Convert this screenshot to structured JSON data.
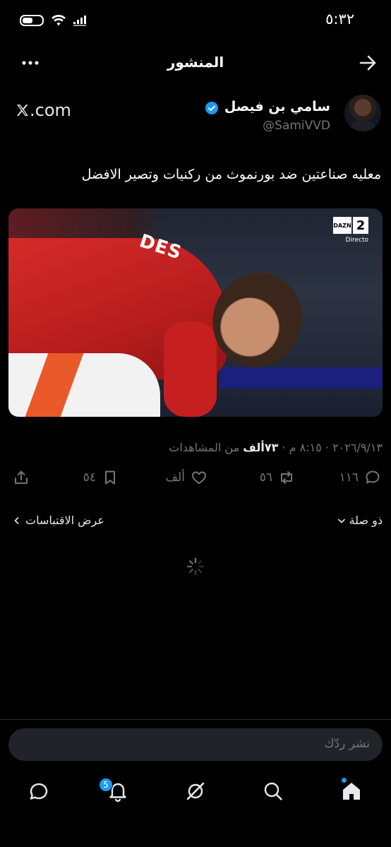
{
  "status": {
    "time": "٥:٣٢"
  },
  "header": {
    "title": "المنشور"
  },
  "author": {
    "name": "سامي بن فيصل",
    "handle": "@SamiVVD",
    "brand": ".com"
  },
  "tweet": {
    "text": "معليه صناعتين ضد بورنموث من ركنيات وتصير الافضل",
    "media": {
      "overlay_brand": "DAZN",
      "overlay_channel": "2",
      "overlay_live": "Directo",
      "shirt_print": "DES"
    }
  },
  "meta": {
    "date": "٢٠٢٦/٩/١٣",
    "time": "٨:١٥ م",
    "views_count": "٧٣ألف",
    "views_label": "من المشاهدات",
    "separator": " · "
  },
  "actions": {
    "replies": "١١٦",
    "reposts": "٥٦",
    "likes": "ألف",
    "bookmarks": "٥٤"
  },
  "sort": {
    "label": "ذو صلة"
  },
  "quotes": {
    "label": "عرض الاقتباسات"
  },
  "reply": {
    "placeholder": "نشر ردّك"
  },
  "tabs": {
    "notifications_badge": "5"
  },
  "colors": {
    "accent": "#1d9bf0",
    "background": "#000000",
    "muted": "#71767b",
    "text": "#e7e9ea"
  }
}
